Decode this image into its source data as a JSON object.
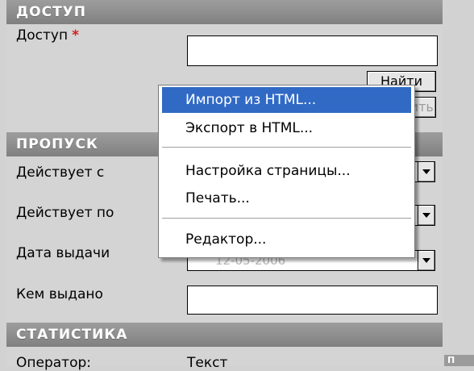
{
  "sections": {
    "access_title": "ДОСТУП",
    "pass_title": "ПРОПУСК",
    "stats_title": "СТАТИСТИКА"
  },
  "access": {
    "label": "Доступ",
    "required_mark": "*",
    "value": "",
    "find_button": "Найти",
    "clear_button": "Очистить"
  },
  "pass": {
    "valid_from_label": "Действует с",
    "valid_to_label": "Действует по",
    "issue_date_label": "Дата выдачи",
    "issue_date_value": "12-05-2006",
    "issued_by_label": "Кем выдано",
    "issued_by_value": ""
  },
  "stats": {
    "operator_label": "Оператор:",
    "operator_value": "Текст"
  },
  "context_menu": {
    "items": [
      {
        "label": "Импорт из HTML..."
      },
      {
        "label": "Экспорт в HTML..."
      },
      {
        "label": "Настройка страницы..."
      },
      {
        "label": "Печать..."
      },
      {
        "label": "Редактор..."
      }
    ],
    "highlighted_index": 0,
    "highlight_color": "#316ac5"
  },
  "corner_tab": {
    "label": "П"
  }
}
